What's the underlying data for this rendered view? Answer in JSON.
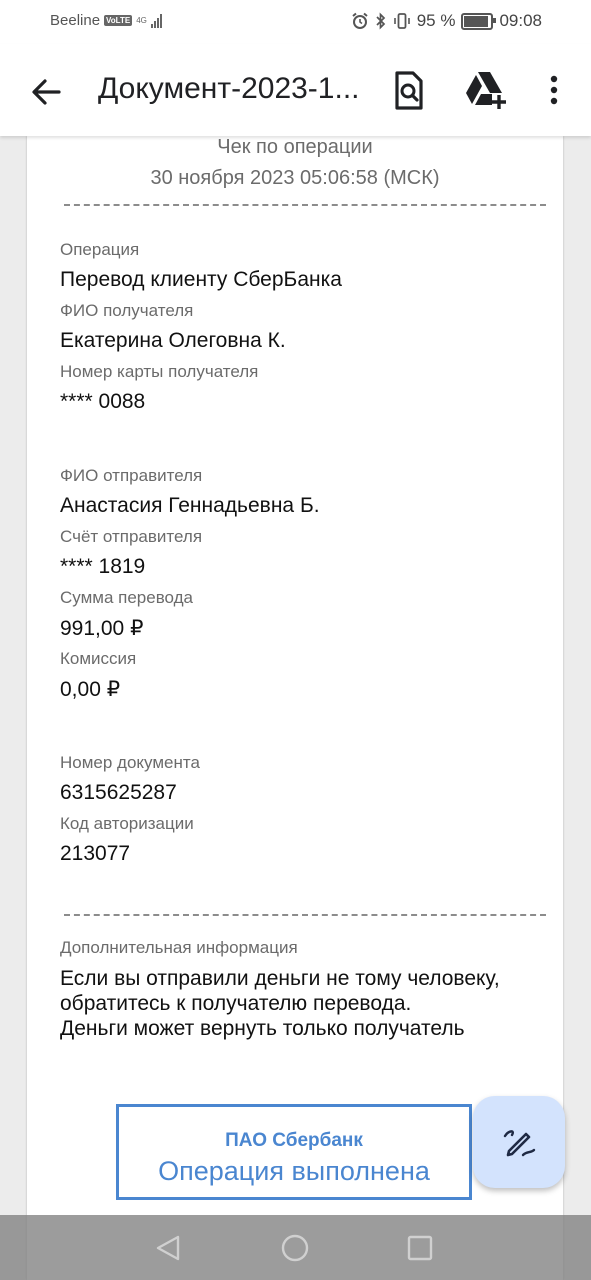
{
  "status_bar": {
    "carrier": "Beeline",
    "volte": "VoLTE",
    "network": "4G",
    "battery": "95 %",
    "time": "09:08"
  },
  "app_bar": {
    "title": "Документ-2023-1..."
  },
  "receipt": {
    "heading": "Чек по операции",
    "datetime": "30 ноября 2023 05:06:58 (МСК)",
    "fields": [
      {
        "label": "Операция",
        "value": "Перевод клиенту СберБанка"
      },
      {
        "label": "ФИО получателя",
        "value": "Екатерина Олеговна К."
      },
      {
        "label": "Номер карты получателя",
        "value": "**** 0088"
      },
      {
        "label": "ФИО отправителя",
        "value": "Анастасия Геннадьевна Б."
      },
      {
        "label": "Счёт отправителя",
        "value": "**** 1819"
      },
      {
        "label": "Сумма перевода",
        "value": "991,00 ₽"
      },
      {
        "label": "Комиссия",
        "value": "0,00 ₽"
      },
      {
        "label": "Номер документа",
        "value": "6315625287"
      },
      {
        "label": "Код авторизации",
        "value": "213077"
      }
    ],
    "additional_label": "Дополнительная информация",
    "additional_lines": [
      "Если вы отправили деньги не тому человеку,",
      "обратитесь к получателю перевода.",
      "Деньги может вернуть только получатель"
    ],
    "stamp": {
      "bank": "ПАО Сбербанк",
      "status": "Операция выполнена"
    }
  },
  "colors": {
    "stamp_blue": "#4a86d0",
    "fab_bg": "#d3e3fd",
    "viewer_bg": "#ececec"
  },
  "icons": {
    "back": "arrow-left-icon",
    "find_in_document": "document-search-icon",
    "drive_add": "drive-add-icon",
    "more": "more-vert-icon",
    "annotate": "pen-annotate-icon",
    "nav_back": "nav-back-icon",
    "nav_home": "nav-home-icon",
    "nav_recents": "nav-recents-icon"
  }
}
